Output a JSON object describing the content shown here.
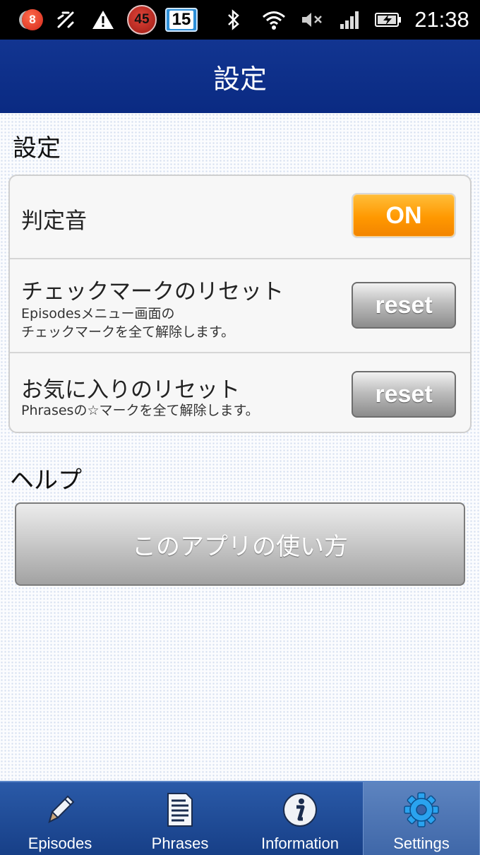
{
  "status_bar": {
    "notification_count": "8",
    "timer_badge": "45",
    "calendar_day": "15",
    "time": "21:38",
    "icons": [
      "notification-badge-icon",
      "usb-debug-icon",
      "warning-icon",
      "timer-icon",
      "calendar-icon",
      "bluetooth-icon",
      "wifi-icon",
      "mute-icon",
      "signal-icon",
      "battery-charging-icon"
    ]
  },
  "header": {
    "title": "設定"
  },
  "settings": {
    "heading": "設定",
    "judge_sound": {
      "label": "判定音",
      "toggle_value": "ON"
    },
    "checkmark_reset": {
      "label": "チェックマークのリセット",
      "description": "Episodesメニュー画面の\nチェックマークを全て解除します。",
      "button_label": "reset"
    },
    "favorites_reset": {
      "label": "お気に入りのリセット",
      "description": "Phrasesの☆マークを全て解除します。",
      "button_label": "reset"
    }
  },
  "help": {
    "heading": "ヘルプ",
    "button_label": "このアプリの使い方"
  },
  "tabs": [
    {
      "label": "Episodes",
      "icon": "pencil-icon",
      "active": false
    },
    {
      "label": "Phrases",
      "icon": "document-icon",
      "active": false
    },
    {
      "label": "Information",
      "icon": "info-icon",
      "active": false
    },
    {
      "label": "Settings",
      "icon": "gear-icon",
      "active": true
    }
  ],
  "colors": {
    "title_bar": "#0f3088",
    "toggle_on": "#ff9800",
    "tab_bar": "#1f4c97"
  }
}
